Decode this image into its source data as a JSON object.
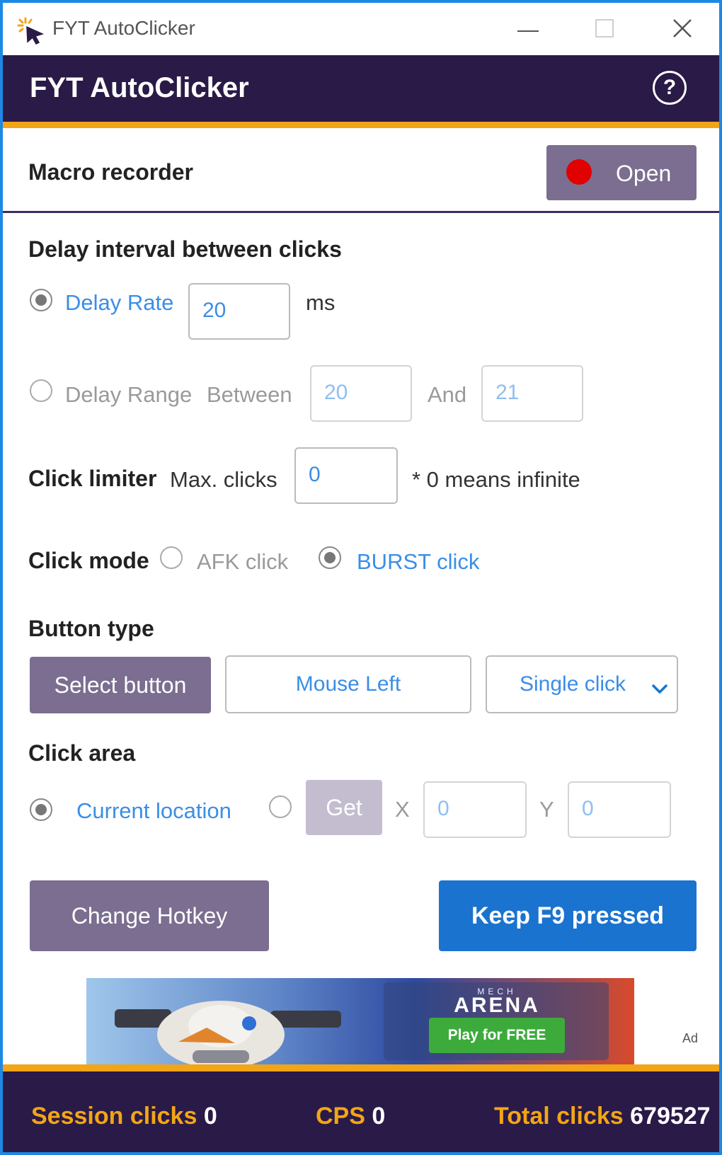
{
  "window": {
    "title": "FYT AutoClicker"
  },
  "header": {
    "title": "FYT AutoClicker",
    "help_label": "?"
  },
  "macro": {
    "label": "Macro recorder",
    "open_label": "Open"
  },
  "delay": {
    "heading": "Delay interval between clicks",
    "rate_label": "Delay Rate",
    "rate_value": "20",
    "rate_unit": "ms",
    "range_label": "Delay Range",
    "between_label": "Between",
    "range_min": "20",
    "and_label": "And",
    "range_max": "21"
  },
  "limiter": {
    "heading": "Click limiter",
    "max_label": "Max. clicks",
    "max_value": "0",
    "note": "* 0 means infinite"
  },
  "mode": {
    "heading": "Click mode",
    "afk_label": "AFK click",
    "burst_label": "BURST click"
  },
  "button_type": {
    "heading": "Button type",
    "select_label": "Select button",
    "mouse_label": "Mouse Left",
    "click_type": "Single click"
  },
  "area": {
    "heading": "Click area",
    "current_label": "Current location",
    "get_label": "Get",
    "x_label": "X",
    "x_value": "0",
    "y_label": "Y",
    "y_value": "0"
  },
  "actions": {
    "hotkey_label": "Change Hotkey",
    "run_label": "Keep F9 pressed"
  },
  "ad": {
    "subtitle": "MECH",
    "title": "ARENA",
    "cta": "Play for FREE",
    "mark": "Ad"
  },
  "footer": {
    "session_label": "Session clicks",
    "session_value": "0",
    "cps_label": "CPS",
    "cps_value": "0",
    "total_label": "Total clicks",
    "total_value": "679527"
  },
  "colors": {
    "header_bg": "#2a1a47",
    "accent_gold": "#f2a516",
    "button_purple": "#7b6e90",
    "primary_blue": "#1a73cf",
    "link_blue": "#3a8ee6",
    "record_red": "#e00000"
  },
  "icons": {
    "app": "cursor-sparkle-icon",
    "minimize": "minimize-icon",
    "maximize": "maximize-icon",
    "close": "close-icon",
    "help": "help-icon",
    "record": "record-dot-icon",
    "dropdown": "chevron-down-icon"
  },
  "state": {
    "delay_mode": "rate",
    "click_mode": "burst",
    "click_area": "current"
  }
}
